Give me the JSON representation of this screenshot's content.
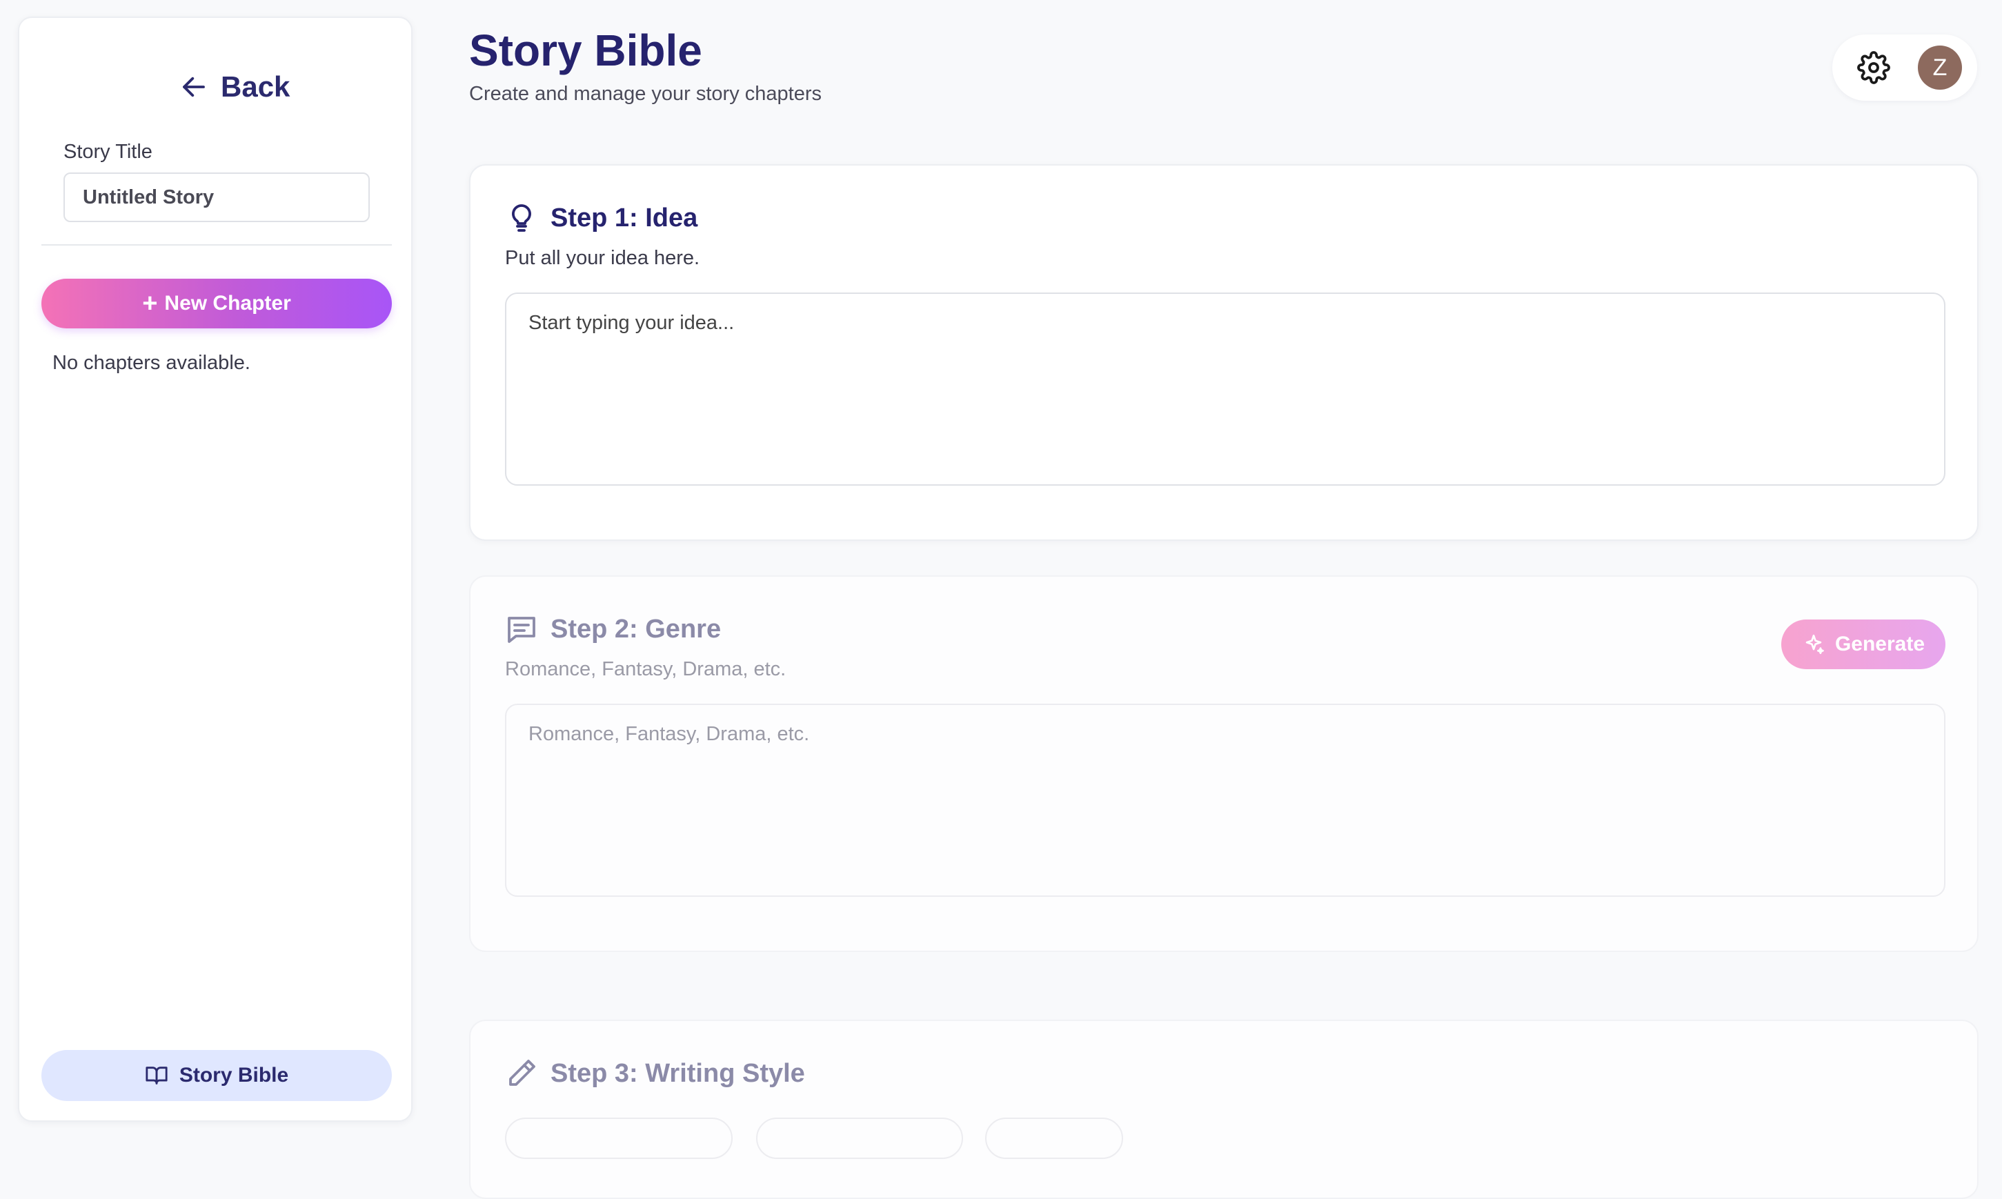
{
  "sidebar": {
    "back_label": "Back",
    "story_title_label": "Story Title",
    "story_title_value": "Untitled Story",
    "new_chapter_label": "New Chapter",
    "no_chapters_text": "No chapters available.",
    "story_bible_label": "Story Bible"
  },
  "header": {
    "title": "Story Bible",
    "subtitle": "Create and manage your story chapters",
    "avatar_initial": "Z",
    "settings_icon": "gear-icon"
  },
  "steps": [
    {
      "title": "Step 1: Idea",
      "description": "Put all your idea here.",
      "placeholder": "Start typing your idea...",
      "icon": "lightbulb-icon"
    },
    {
      "title": "Step 2: Genre",
      "description": "Romance, Fantasy, Drama, etc.",
      "placeholder": "Romance, Fantasy, Drama, etc.",
      "icon": "message-icon",
      "action_label": "Generate"
    },
    {
      "title": "Step 3: Writing Style",
      "icon": "pencil-icon"
    }
  ],
  "colors": {
    "primary_text": "#26236e",
    "gradient_start": "#f472b6",
    "gradient_end": "#a855f7",
    "story_bible_bg": "#e0e7ff"
  }
}
